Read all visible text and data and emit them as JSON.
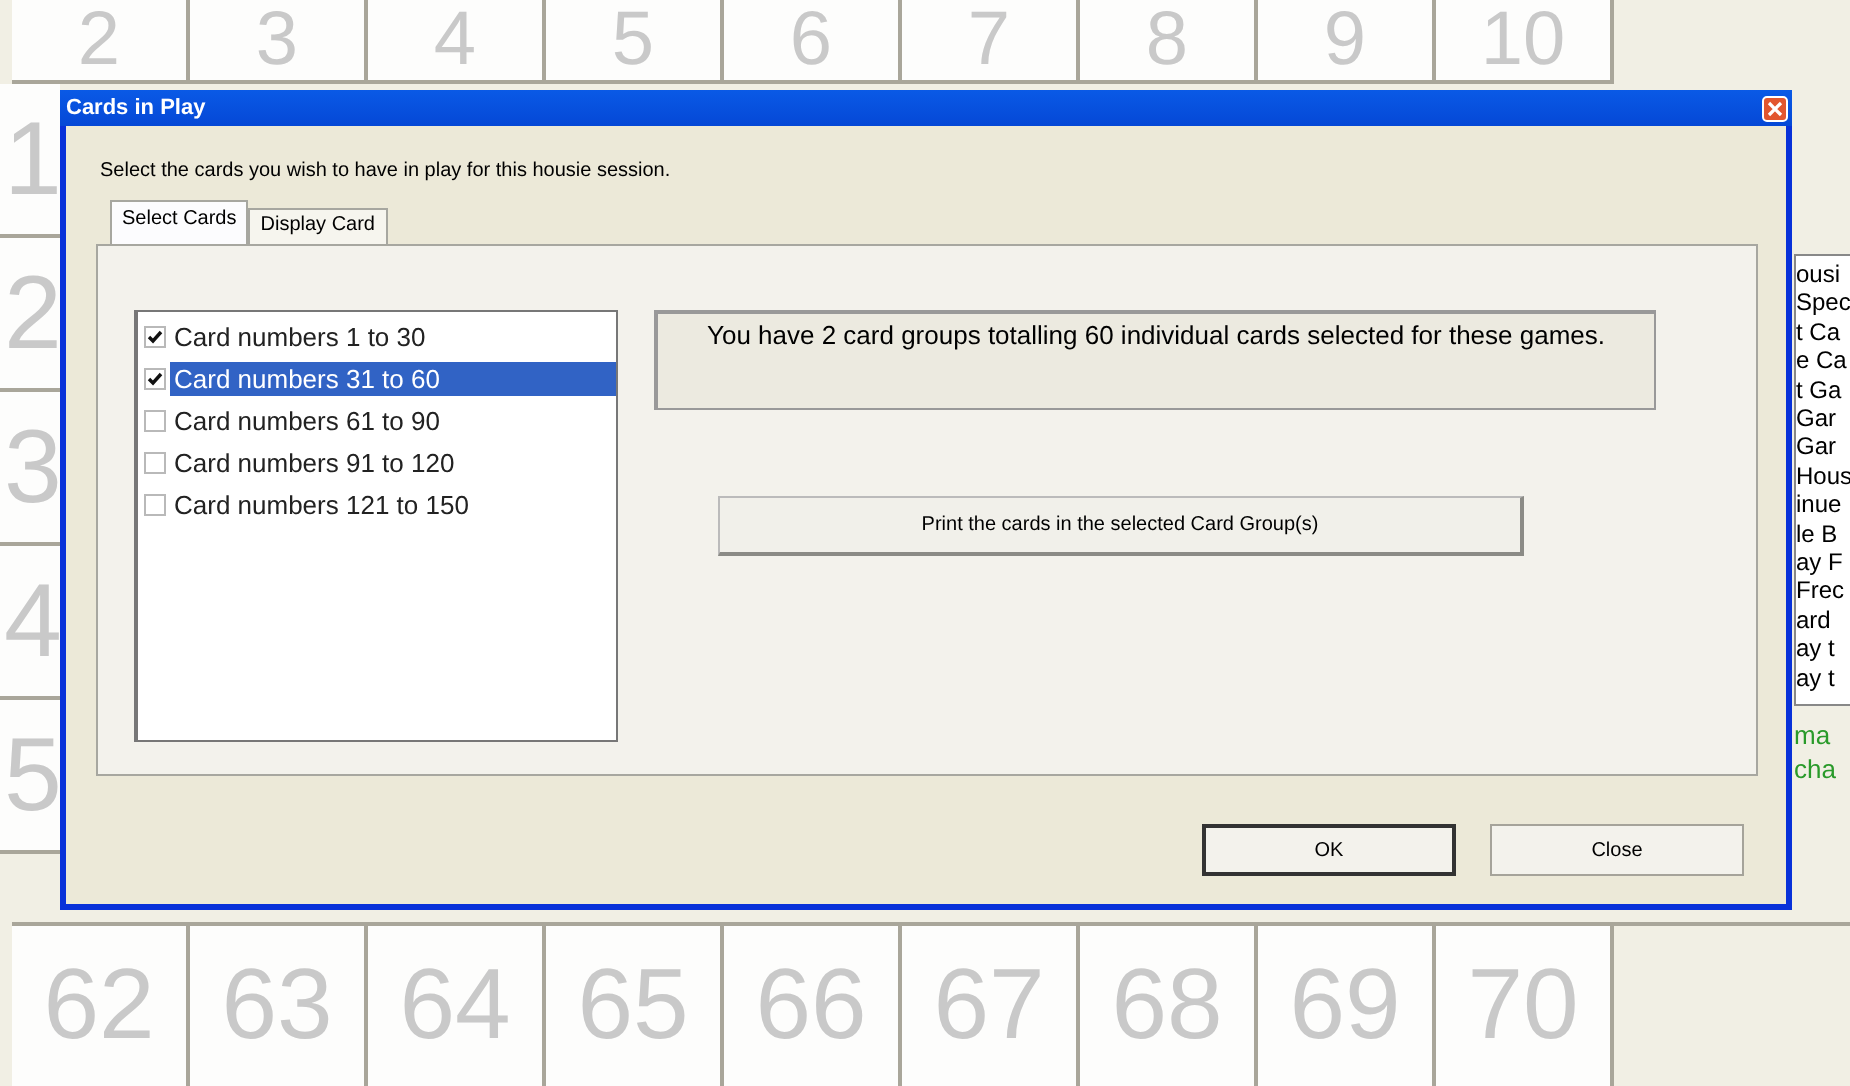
{
  "board": {
    "top_row": [
      "2",
      "3",
      "4",
      "5",
      "6",
      "7",
      "8",
      "9",
      "10"
    ],
    "left_column": [
      "1",
      "2",
      "3",
      "4",
      "5"
    ],
    "bottom_row": [
      "62",
      "63",
      "64",
      "65",
      "66",
      "67",
      "68",
      "69",
      "70"
    ]
  },
  "side_panel": {
    "lines": [
      "ousi",
      "Spec",
      "t Ca",
      "e Ca",
      "t Ga",
      "Gar",
      "Gar",
      "Hous",
      "inue",
      "le B",
      "ay F",
      "Frec",
      "ard",
      "ay t",
      "ay t"
    ],
    "notes": [
      "ma",
      "cha"
    ]
  },
  "dialog": {
    "title": "Cards in Play",
    "instruction": "Select the cards you wish to have in play for this housie session.",
    "tabs": [
      {
        "label": "Select Cards",
        "selected": true
      },
      {
        "label": "Display Card",
        "selected": false
      }
    ],
    "card_groups": [
      {
        "label": "Card numbers 1 to 30",
        "checked": true,
        "selected": false
      },
      {
        "label": "Card numbers 31 to 60",
        "checked": true,
        "selected": true
      },
      {
        "label": "Card numbers 61 to 90",
        "checked": false,
        "selected": false
      },
      {
        "label": "Card numbers 91 to 120",
        "checked": false,
        "selected": false
      },
      {
        "label": "Card numbers 121 to 150",
        "checked": false,
        "selected": false
      }
    ],
    "summary": "You have 2 card groups totalling 60 individual cards selected for these games.",
    "print_button": "Print the cards in the selected Card Group(s)",
    "buttons": [
      {
        "label": "OK",
        "default": true
      },
      {
        "label": "Close",
        "default": false
      }
    ]
  }
}
